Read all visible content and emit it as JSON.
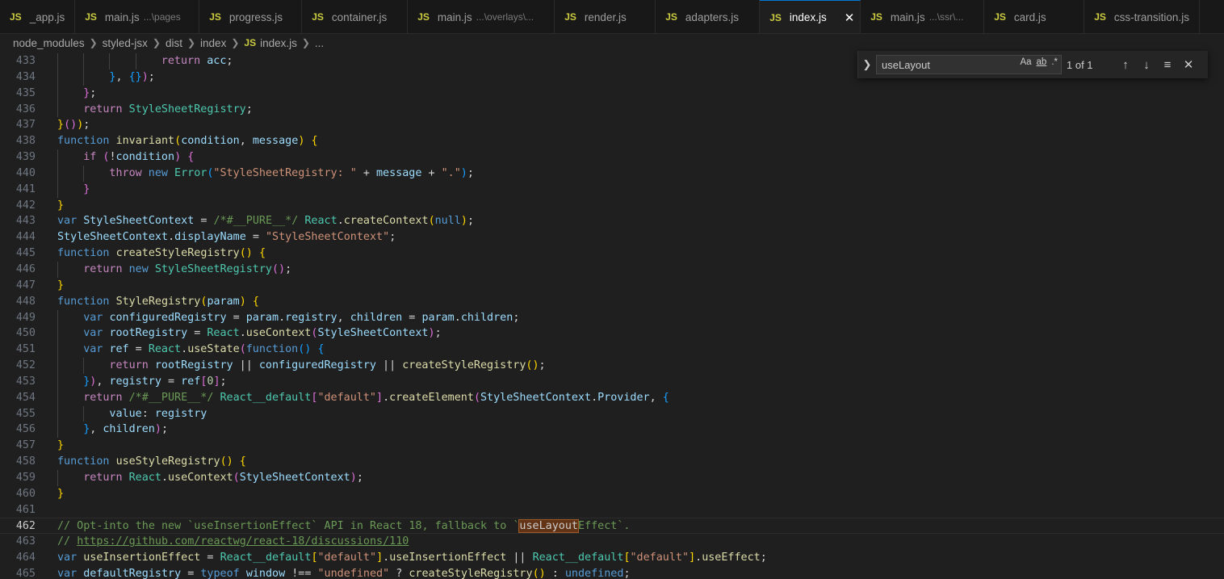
{
  "tabs": [
    {
      "icon": "JS",
      "label": "_app.js",
      "desc": ""
    },
    {
      "icon": "JS",
      "label": "main.js",
      "desc": "...\\pages"
    },
    {
      "icon": "JS",
      "label": "progress.js",
      "desc": ""
    },
    {
      "icon": "JS",
      "label": "container.js",
      "desc": ""
    },
    {
      "icon": "JS",
      "label": "main.js",
      "desc": "...\\overlays\\..."
    },
    {
      "icon": "JS",
      "label": "render.js",
      "desc": ""
    },
    {
      "icon": "JS",
      "label": "adapters.js",
      "desc": ""
    },
    {
      "icon": "JS",
      "label": "index.js",
      "desc": "",
      "close": "✕"
    },
    {
      "icon": "JS",
      "label": "main.js",
      "desc": "...\\ssr\\..."
    },
    {
      "icon": "JS",
      "label": "card.js",
      "desc": ""
    },
    {
      "icon": "JS",
      "label": "css-transition.js",
      "desc": ""
    }
  ],
  "breadcrumb": {
    "parts": [
      "node_modules",
      "styled-jsx",
      "dist",
      "index"
    ],
    "file_icon": "JS",
    "file": "index.js",
    "more": "..."
  },
  "find": {
    "query": "useLayout",
    "match_case": "Aa",
    "whole_word": "ab",
    "regex": ".*",
    "count": "1 of 1",
    "expand_icon": "chevron-right-icon",
    "prev_icon": "arrow-up-icon",
    "next_icon": "arrow-down-icon",
    "selection_icon": "find-in-selection-icon",
    "close_icon": "close-icon"
  },
  "editor": {
    "current_line": "462",
    "lines": [
      {
        "n": "433"
      },
      {
        "n": "434"
      },
      {
        "n": "435"
      },
      {
        "n": "436"
      },
      {
        "n": "437"
      },
      {
        "n": "438"
      },
      {
        "n": "439"
      },
      {
        "n": "440"
      },
      {
        "n": "441"
      },
      {
        "n": "442"
      },
      {
        "n": "443"
      },
      {
        "n": "444"
      },
      {
        "n": "445"
      },
      {
        "n": "446"
      },
      {
        "n": "447"
      },
      {
        "n": "448"
      },
      {
        "n": "449"
      },
      {
        "n": "450"
      },
      {
        "n": "451"
      },
      {
        "n": "452"
      },
      {
        "n": "453"
      },
      {
        "n": "454"
      },
      {
        "n": "455"
      },
      {
        "n": "456"
      },
      {
        "n": "457"
      },
      {
        "n": "458"
      },
      {
        "n": "459"
      },
      {
        "n": "460"
      },
      {
        "n": "461"
      },
      {
        "n": "462"
      },
      {
        "n": "463"
      },
      {
        "n": "464"
      },
      {
        "n": "465"
      }
    ],
    "code": {
      "l433": [
        [
          "ct",
          "return"
        ],
        [
          "pl",
          " "
        ],
        [
          "vr",
          "acc"
        ],
        [
          "pl",
          ";"
        ]
      ],
      "l434": [
        [
          "b3",
          "}"
        ],
        [
          "pl",
          ", "
        ],
        [
          "b3",
          "{}"
        ],
        [
          "b2",
          ")"
        ],
        [
          "pl",
          ";"
        ]
      ],
      "l435": [
        [
          "b2",
          "}"
        ],
        [
          "pl",
          ";"
        ]
      ],
      "l436": [
        [
          "ct",
          "return"
        ],
        [
          "pl",
          " "
        ],
        [
          "ty",
          "StyleSheetRegistry"
        ],
        [
          "pl",
          ";"
        ]
      ],
      "l437": [
        [
          "b1",
          "}"
        ],
        [
          "b2",
          "()"
        ],
        [
          "b1",
          ")"
        ],
        [
          "pl",
          ";"
        ]
      ],
      "l438": [
        [
          "kw",
          "function"
        ],
        [
          "pl",
          " "
        ],
        [
          "fn",
          "invariant"
        ],
        [
          "b1",
          "("
        ],
        [
          "vr",
          "condition"
        ],
        [
          "pl",
          ", "
        ],
        [
          "vr",
          "message"
        ],
        [
          "b1",
          ")"
        ],
        [
          "pl",
          " "
        ],
        [
          "b1",
          "{"
        ]
      ],
      "l439": [
        [
          "ct",
          "if"
        ],
        [
          "pl",
          " "
        ],
        [
          "b2",
          "("
        ],
        [
          "pl",
          "!"
        ],
        [
          "vr",
          "condition"
        ],
        [
          "b2",
          ")"
        ],
        [
          "pl",
          " "
        ],
        [
          "b2",
          "{"
        ]
      ],
      "l440": [
        [
          "ct",
          "throw"
        ],
        [
          "pl",
          " "
        ],
        [
          "kw",
          "new"
        ],
        [
          "pl",
          " "
        ],
        [
          "ty",
          "Error"
        ],
        [
          "b3",
          "("
        ],
        [
          "st",
          "\"StyleSheetRegistry: \""
        ],
        [
          "pl",
          " + "
        ],
        [
          "vr",
          "message"
        ],
        [
          "pl",
          " + "
        ],
        [
          "st",
          "\".\""
        ],
        [
          "b3",
          ")"
        ],
        [
          "pl",
          ";"
        ]
      ],
      "l441": [
        [
          "b2",
          "}"
        ]
      ],
      "l442": [
        [
          "b1",
          "}"
        ]
      ],
      "l443": [
        [
          "kw",
          "var"
        ],
        [
          "pl",
          " "
        ],
        [
          "vr",
          "StyleSheetContext"
        ],
        [
          "pl",
          " = "
        ],
        [
          "cm",
          "/*#__PURE__*/"
        ],
        [
          "pl",
          " "
        ],
        [
          "ty",
          "React"
        ],
        [
          "pl",
          "."
        ],
        [
          "fn",
          "createContext"
        ],
        [
          "b1",
          "("
        ],
        [
          "kw",
          "null"
        ],
        [
          "b1",
          ")"
        ],
        [
          "pl",
          ";"
        ]
      ],
      "l444": [
        [
          "vr",
          "StyleSheetContext"
        ],
        [
          "pl",
          "."
        ],
        [
          "vr",
          "displayName"
        ],
        [
          "pl",
          " = "
        ],
        [
          "st",
          "\"StyleSheetContext\""
        ],
        [
          "pl",
          ";"
        ]
      ],
      "l445": [
        [
          "kw",
          "function"
        ],
        [
          "pl",
          " "
        ],
        [
          "fn",
          "createStyleRegistry"
        ],
        [
          "b1",
          "()"
        ],
        [
          "pl",
          " "
        ],
        [
          "b1",
          "{"
        ]
      ],
      "l446": [
        [
          "ct",
          "return"
        ],
        [
          "pl",
          " "
        ],
        [
          "kw",
          "new"
        ],
        [
          "pl",
          " "
        ],
        [
          "ty",
          "StyleSheetRegistry"
        ],
        [
          "b2",
          "()"
        ],
        [
          "pl",
          ";"
        ]
      ],
      "l447": [
        [
          "b1",
          "}"
        ]
      ],
      "l448": [
        [
          "kw",
          "function"
        ],
        [
          "pl",
          " "
        ],
        [
          "fn",
          "StyleRegistry"
        ],
        [
          "b1",
          "("
        ],
        [
          "vr",
          "param"
        ],
        [
          "b1",
          ")"
        ],
        [
          "pl",
          " "
        ],
        [
          "b1",
          "{"
        ]
      ],
      "l449": [
        [
          "kw",
          "var"
        ],
        [
          "pl",
          " "
        ],
        [
          "vr",
          "configuredRegistry"
        ],
        [
          "pl",
          " = "
        ],
        [
          "vr",
          "param"
        ],
        [
          "pl",
          "."
        ],
        [
          "vr",
          "registry"
        ],
        [
          "pl",
          ", "
        ],
        [
          "vr",
          "children"
        ],
        [
          "pl",
          " = "
        ],
        [
          "vr",
          "param"
        ],
        [
          "pl",
          "."
        ],
        [
          "vr",
          "children"
        ],
        [
          "pl",
          ";"
        ]
      ],
      "l450": [
        [
          "kw",
          "var"
        ],
        [
          "pl",
          " "
        ],
        [
          "vr",
          "rootRegistry"
        ],
        [
          "pl",
          " = "
        ],
        [
          "ty",
          "React"
        ],
        [
          "pl",
          "."
        ],
        [
          "fn",
          "useContext"
        ],
        [
          "b2",
          "("
        ],
        [
          "vr",
          "StyleSheetContext"
        ],
        [
          "b2",
          ")"
        ],
        [
          "pl",
          ";"
        ]
      ],
      "l451": [
        [
          "kw",
          "var"
        ],
        [
          "pl",
          " "
        ],
        [
          "vr",
          "ref"
        ],
        [
          "pl",
          " = "
        ],
        [
          "ty",
          "React"
        ],
        [
          "pl",
          "."
        ],
        [
          "fn",
          "useState"
        ],
        [
          "b2",
          "("
        ],
        [
          "kw",
          "function"
        ],
        [
          "b3",
          "()"
        ],
        [
          "pl",
          " "
        ],
        [
          "b3",
          "{"
        ]
      ],
      "l452": [
        [
          "ct",
          "return"
        ],
        [
          "pl",
          " "
        ],
        [
          "vr",
          "rootRegistry"
        ],
        [
          "pl",
          " || "
        ],
        [
          "vr",
          "configuredRegistry"
        ],
        [
          "pl",
          " || "
        ],
        [
          "fn",
          "createStyleRegistry"
        ],
        [
          "b1",
          "()"
        ],
        [
          "pl",
          ";"
        ]
      ],
      "l453": [
        [
          "b3",
          "}"
        ],
        [
          "b2",
          ")"
        ],
        [
          "pl",
          ", "
        ],
        [
          "vr",
          "registry"
        ],
        [
          "pl",
          " = "
        ],
        [
          "vr",
          "ref"
        ],
        [
          "b2",
          "["
        ],
        [
          "nm",
          "0"
        ],
        [
          "b2",
          "]"
        ],
        [
          "pl",
          ";"
        ]
      ],
      "l454": [
        [
          "ct",
          "return"
        ],
        [
          "pl",
          " "
        ],
        [
          "cm",
          "/*#__PURE__*/"
        ],
        [
          "pl",
          " "
        ],
        [
          "ty",
          "React__default"
        ],
        [
          "b2",
          "["
        ],
        [
          "st",
          "\"default\""
        ],
        [
          "b2",
          "]"
        ],
        [
          "pl",
          "."
        ],
        [
          "fn",
          "createElement"
        ],
        [
          "b2",
          "("
        ],
        [
          "vr",
          "StyleSheetContext"
        ],
        [
          "pl",
          "."
        ],
        [
          "vr",
          "Provider"
        ],
        [
          "pl",
          ", "
        ],
        [
          "b3",
          "{"
        ]
      ],
      "l455": [
        [
          "vr",
          "value"
        ],
        [
          "pl",
          ": "
        ],
        [
          "vr",
          "registry"
        ]
      ],
      "l456": [
        [
          "b3",
          "}"
        ],
        [
          "pl",
          ", "
        ],
        [
          "vr",
          "children"
        ],
        [
          "b2",
          ")"
        ],
        [
          "pl",
          ";"
        ]
      ],
      "l457": [
        [
          "b1",
          "}"
        ]
      ],
      "l458": [
        [
          "kw",
          "function"
        ],
        [
          "pl",
          " "
        ],
        [
          "fn",
          "useStyleRegistry"
        ],
        [
          "b1",
          "()"
        ],
        [
          "pl",
          " "
        ],
        [
          "b1",
          "{"
        ]
      ],
      "l459": [
        [
          "ct",
          "return"
        ],
        [
          "pl",
          " "
        ],
        [
          "ty",
          "React"
        ],
        [
          "pl",
          "."
        ],
        [
          "fn",
          "useContext"
        ],
        [
          "b2",
          "("
        ],
        [
          "vr",
          "StyleSheetContext"
        ],
        [
          "b2",
          ")"
        ],
        [
          "pl",
          ";"
        ]
      ],
      "l460": [
        [
          "b1",
          "}"
        ]
      ],
      "l461": [],
      "l462": [
        [
          "cm",
          "// Opt-into the new `useInsertionEffect` API in React 18, fallback to `"
        ],
        [
          "hl",
          "useLayout"
        ],
        [
          "cm",
          "Effect`."
        ]
      ],
      "l463": [
        [
          "cm",
          "// "
        ],
        [
          "cm-link",
          "https://github.com/reactwg/react-18/discussions/110"
        ]
      ],
      "l464": [
        [
          "kw",
          "var"
        ],
        [
          "pl",
          " "
        ],
        [
          "fn",
          "useInsertionEffect"
        ],
        [
          "pl",
          " = "
        ],
        [
          "ty",
          "React__default"
        ],
        [
          "b1",
          "["
        ],
        [
          "st",
          "\"default\""
        ],
        [
          "b1",
          "]"
        ],
        [
          "pl",
          "."
        ],
        [
          "fn",
          "useInsertionEffect"
        ],
        [
          "pl",
          " || "
        ],
        [
          "ty",
          "React__default"
        ],
        [
          "b1",
          "["
        ],
        [
          "st",
          "\"default\""
        ],
        [
          "b1",
          "]"
        ],
        [
          "pl",
          "."
        ],
        [
          "fn",
          "useEffect"
        ],
        [
          "pl",
          ";"
        ]
      ],
      "l465": [
        [
          "kw",
          "var"
        ],
        [
          "pl",
          " "
        ],
        [
          "vr",
          "defaultRegistry"
        ],
        [
          "pl",
          " = "
        ],
        [
          "kw",
          "typeof"
        ],
        [
          "pl",
          " "
        ],
        [
          "vr",
          "window"
        ],
        [
          "pl",
          " !== "
        ],
        [
          "st",
          "\"undefined\""
        ],
        [
          "pl",
          " ? "
        ],
        [
          "fn",
          "createStyleRegistry"
        ],
        [
          "b1",
          "()"
        ],
        [
          "pl",
          " : "
        ],
        [
          "kw",
          "undefined"
        ],
        [
          "pl",
          ";"
        ]
      ]
    }
  }
}
